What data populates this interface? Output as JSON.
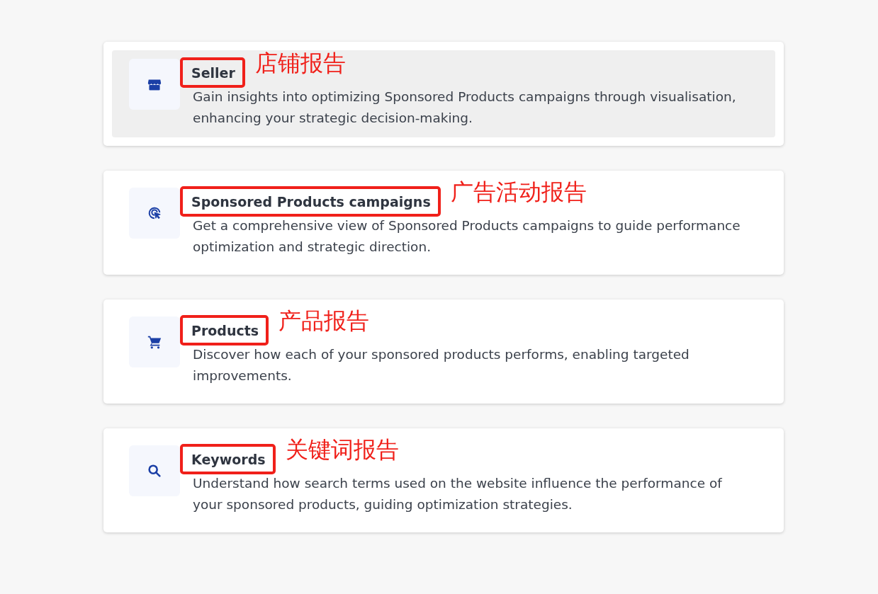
{
  "reports": [
    {
      "kind": "store",
      "title": "Seller",
      "note": "店铺报告",
      "description": "Gain insights into optimizing Sponsored Products campaigns through visualisation, enhancing your strategic decision-making.",
      "selected": true
    },
    {
      "kind": "target",
      "title": "Sponsored Products campaigns",
      "note": "广告活动报告",
      "description": "Get a comprehensive view of Sponsored Products campaigns to guide performance optimization and strategic direction.",
      "selected": false
    },
    {
      "kind": "cart",
      "title": "Products",
      "note": "产品报告",
      "description": "Discover how each of your sponsored products performs, enabling targeted improvements.",
      "selected": false
    },
    {
      "kind": "search",
      "title": "Keywords",
      "note": "关键词报告",
      "description": "Understand how search terms used on the website influence the performance of your sponsored products, guiding optimization strategies.",
      "selected": false
    }
  ]
}
